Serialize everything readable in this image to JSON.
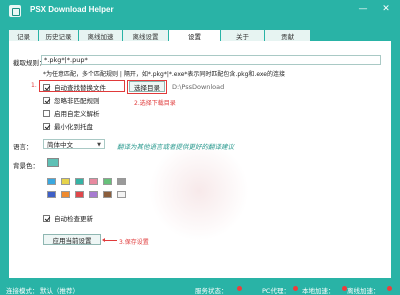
{
  "app": {
    "title": "PSX Download Helper",
    "minimize_glyph": "—",
    "close_glyph": "✕"
  },
  "tabs": [
    {
      "label": "记录",
      "active": false
    },
    {
      "label": "历史记录",
      "active": false
    },
    {
      "label": "离线加速",
      "active": false
    },
    {
      "label": "离线设置",
      "active": false
    },
    {
      "label": "设置",
      "active": true
    },
    {
      "label": "关于",
      "active": false
    },
    {
      "label": "贡献",
      "active": false
    }
  ],
  "settings": {
    "intercept_rule_label": "截取规则：",
    "intercept_rule_value": "*.pkg*|*.pup*",
    "rule_hint": "*为任意匹配，多个匹配规则 | 隔开，如*.pkg*|*.exe*表示同时匹配包含.pkg和.exe的连接",
    "auto_replace_label": "自动查找替换文件",
    "auto_replace_checked": true,
    "ignore_mismatch_label": "忽略非匹配规则",
    "ignore_mismatch_checked": true,
    "custom_parse_label": "启用自定义解析",
    "custom_parse_checked": false,
    "minimize_tray_label": "最小化到托盘",
    "minimize_tray_checked": true,
    "choose_dir_button": "选择目录",
    "dir_path": "D:\\PssDownload",
    "language_label": "语言：",
    "language_value": "简体中文",
    "translate_link": "翻译为其他语言或者提供更好的翻译建议",
    "bg_color_label": "背景色：",
    "current_color": "#5ec0b5",
    "palette": [
      "#3aa8e0",
      "#e6d34a",
      "#35b3a5",
      "#e88aa0",
      "#67c07a",
      "#9a9a9a",
      "#3d5fc7",
      "#ef8a2e",
      "#e0474a",
      "#a77bd1",
      "#8b5e3c",
      "#f3f3f3"
    ],
    "auto_update_label": "自动检查更新",
    "auto_update_checked": true,
    "apply_button": "应用当前设置"
  },
  "annotations": {
    "step1": "1.",
    "step2": "2.选择下载目录",
    "step3": "3.保存设置"
  },
  "status": {
    "connection_label": "连接模式：",
    "connection_value": "默认（推荐）",
    "service_label": "服务状态：",
    "proxy_label": "PC代理：",
    "local_accel_label": "本地加速：",
    "offline_accel_label": "离线加速：",
    "colors": {
      "service": "#ee3b3b",
      "proxy": "#ee3b3b",
      "local": "#ee3b3b",
      "offline": "#ee3b3b"
    }
  }
}
